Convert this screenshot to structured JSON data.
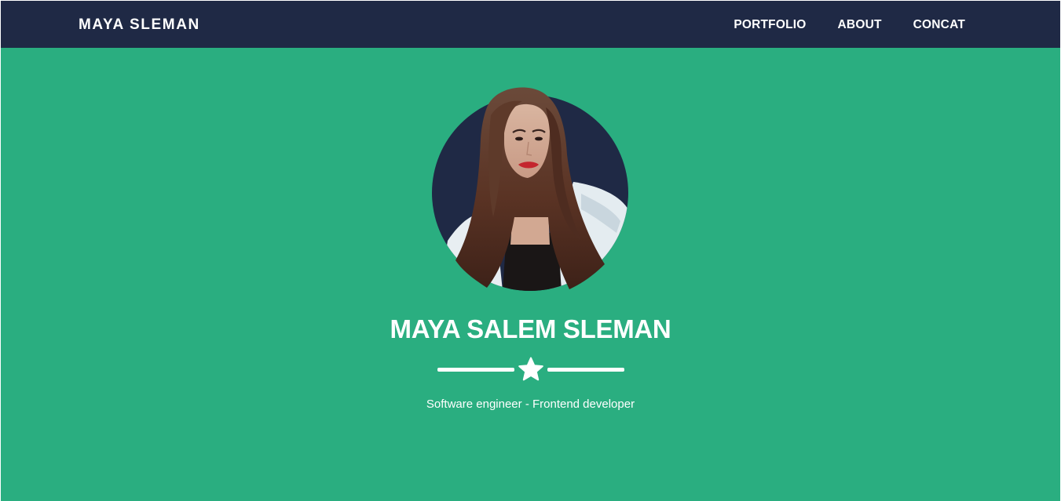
{
  "navbar": {
    "brand": "MAYA SLEMAN",
    "links": [
      {
        "label": "PORTFOLIO"
      },
      {
        "label": "ABOUT"
      },
      {
        "label": "CONCAT"
      }
    ]
  },
  "hero": {
    "avatar_icon": "profile-photo",
    "name": "MAYA SALEM SLEMAN",
    "divider_icon": "star-icon",
    "subtitle": "Software engineer - Frontend developer"
  },
  "colors": {
    "navbar_bg": "#1f2945",
    "hero_bg": "#2aae80",
    "text": "#ffffff",
    "avatar_bg": "#1f2945"
  }
}
